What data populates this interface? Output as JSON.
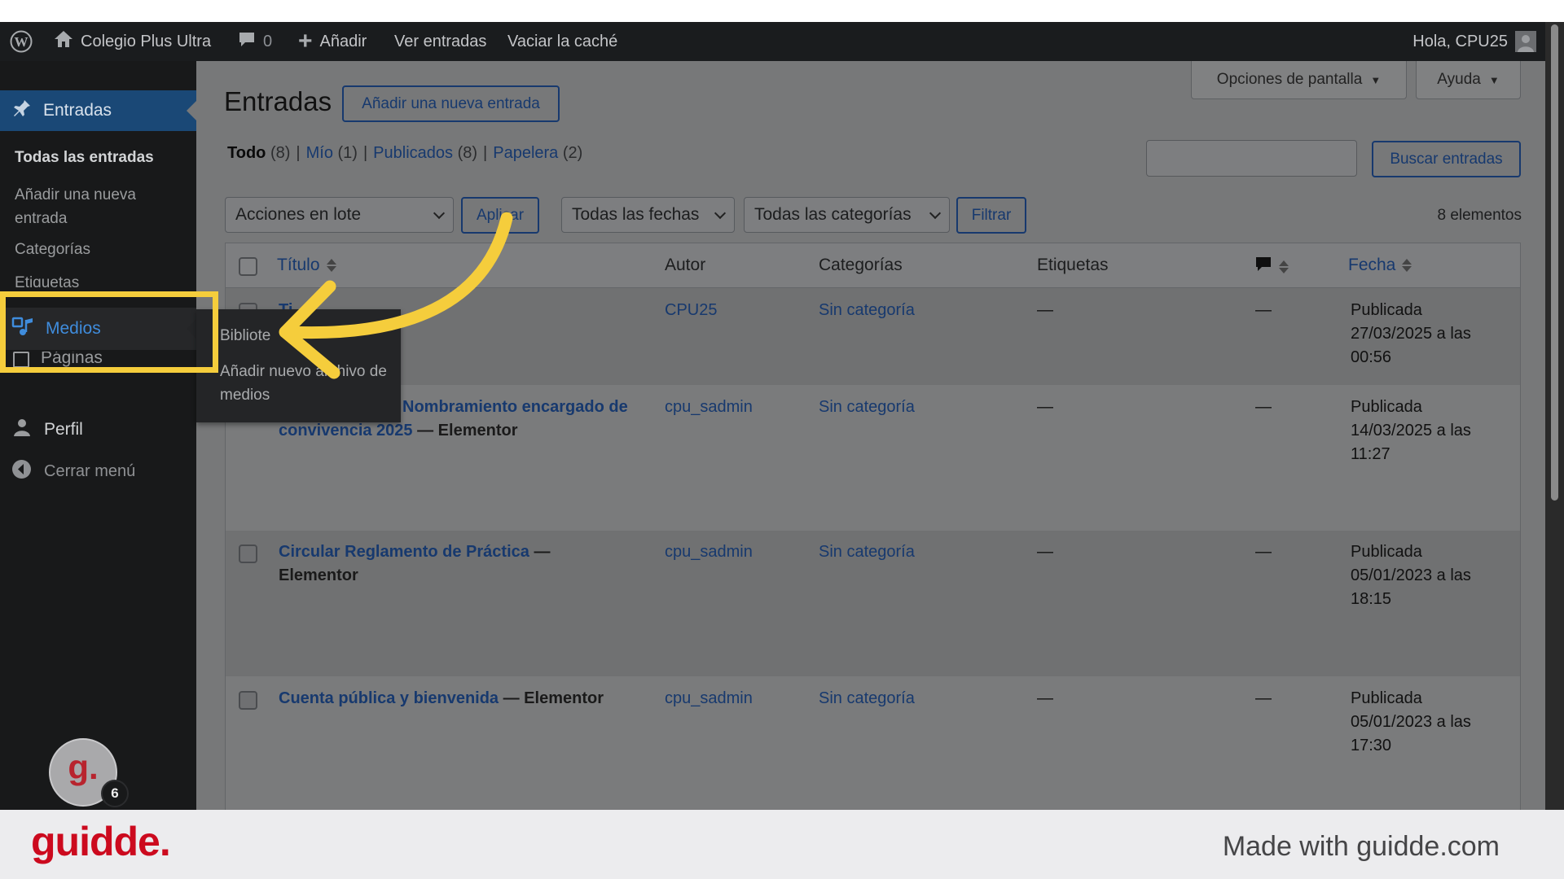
{
  "adminbar": {
    "site_name": "Colegio Plus Ultra",
    "comments_count": "0",
    "add_label": "Añadir",
    "view_posts": "Ver entradas",
    "clear_cache": "Vaciar la caché",
    "greeting": "Hola, CPU25"
  },
  "sidebar": {
    "posts_label": "Entradas",
    "submenu": [
      "Todas las entradas",
      "Añadir una nueva entrada",
      "Categorías",
      "Etiquetas"
    ],
    "media_label": "Medios",
    "pages_label": "Páginas",
    "profile_label": "Perfil",
    "collapse_label": "Cerrar menú",
    "flyout": [
      "Biblioteca",
      "Añadir nuevo archivo de medios"
    ],
    "flyout_visible": [
      "Bibliote",
      "Añadir nuevo archivo de medios"
    ]
  },
  "header": {
    "title": "Entradas",
    "add_new": "Añadir una nueva entrada",
    "screen_options": "Opciones de pantalla",
    "help": "Ayuda"
  },
  "filters": {
    "all": "Todo",
    "all_count": "(8)",
    "mine": "Mío",
    "mine_count": "(1)",
    "published": "Publicados",
    "published_count": "(8)",
    "trash": "Papelera",
    "trash_count": "(2)",
    "search_button": "Buscar entradas",
    "search_value": "",
    "bulk_actions": "Acciones en lote",
    "apply": "Aplicar",
    "dates": "Todas las fechas",
    "categories": "Todas las categorías",
    "filter": "Filtrar",
    "items_count": "8 elementos"
  },
  "table": {
    "headers": {
      "title": "Título",
      "author": "Autor",
      "categories": "Categorías",
      "tags": "Etiquetas",
      "date": "Fecha"
    },
    "rows": [
      {
        "title": "Ti",
        "suffix": "",
        "author": "CPU25",
        "category": "Sin categoría",
        "tags": "—",
        "comments": "—",
        "status": "Publicada",
        "date": "27/03/2025 a las",
        "time": "00:56"
      },
      {
        "title": "Nombramiento encargado de convivencia 2025",
        "suffix": "— Elementor",
        "author": "cpu_sadmin",
        "category": "Sin categoría",
        "tags": "—",
        "comments": "—",
        "status": "Publicada",
        "date": "14/03/2025 a las",
        "time": "11:27"
      },
      {
        "title": "Circular Reglamento de Práctica",
        "suffix": "— Elementor",
        "author": "cpu_sadmin",
        "category": "Sin categoría",
        "tags": "—",
        "comments": "—",
        "status": "Publicada",
        "date": "05/01/2023 a las",
        "time": "18:15"
      },
      {
        "title": "Cuenta pública y bienvenida",
        "suffix": "— Elementor",
        "author": "cpu_sadmin",
        "category": "Sin categoría",
        "tags": "—",
        "comments": "—",
        "status": "Publicada",
        "date": "05/01/2023 a las",
        "time": "17:30"
      }
    ]
  },
  "guidde": {
    "avatar_letter": "g.",
    "badge_count": "6",
    "logo": "guidde.",
    "made_with": "Made with guidde.com"
  },
  "colors": {
    "highlight": "#f5cd3c",
    "accent": "#1d5aa8",
    "brand_red": "#cc0a1e"
  },
  "icons": [
    "wordpress-logo-icon",
    "home-icon",
    "comment-bubble-icon",
    "plus-icon",
    "user-avatar-icon",
    "pushpin-icon",
    "media-icon",
    "pages-icon",
    "person-icon",
    "collapse-arrow-icon",
    "sort-icon",
    "comments-column-icon",
    "annotation-arrow"
  ]
}
